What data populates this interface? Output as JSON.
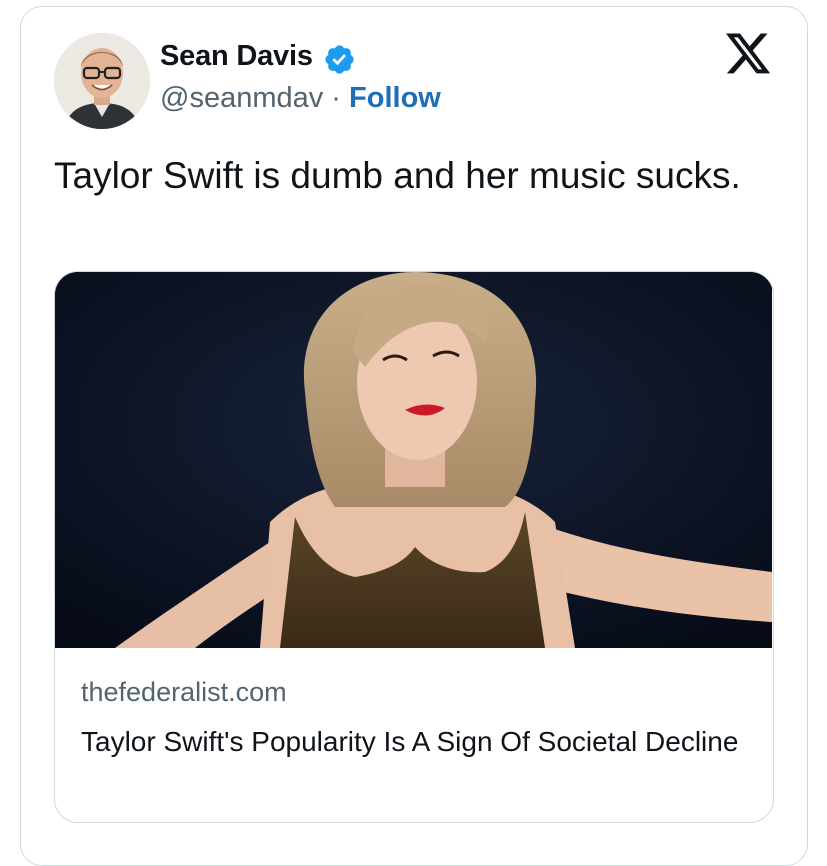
{
  "author": {
    "name": "Sean Davis",
    "handle": "@seanmdav",
    "separator": " · ",
    "follow_label": "Follow",
    "verified_icon": "verified-badge-icon",
    "avatar_icon": "profile-avatar"
  },
  "platform": {
    "logo_icon": "x-logo-icon"
  },
  "tweet": {
    "text": "Taylor Swift is dumb and her music sucks."
  },
  "link_card": {
    "image": "performer-on-stage-photo",
    "domain": "thefederalist.com",
    "title": "Taylor Swift's Popularity Is A Sign Of Societal Decline"
  },
  "colors": {
    "follow": "#1d6fb8",
    "verified": "#1d9bf0",
    "secondary_text": "#536471",
    "border": "#cfd9de"
  }
}
